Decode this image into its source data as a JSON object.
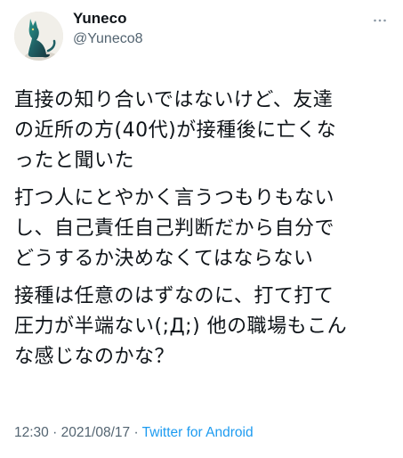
{
  "user": {
    "display_name": "Yuneco",
    "handle": "@Yuneco8"
  },
  "header": {
    "more_icon": "more-horizontal-icon"
  },
  "tweet": {
    "paragraphs": [
      "直接の知り合いではないけど、友達\nの近所の方(40代)が接種後に亡くな\nったと聞いた",
      "打つ人にとやかく言うつもりもない\nし、自己責任自己判断だから自分で\nどうするか決めなくてはならない",
      "接種は任意のはずなのに、打て打て\n圧力が半端ない(;Д;) 他の職場もこん\nな感じなのかな？"
    ]
  },
  "meta": {
    "time": "12:30",
    "separator_1": " · ",
    "date": "2021/08/17",
    "separator_2": " · ",
    "source": "Twitter for Android"
  },
  "colors": {
    "text": "#0f1419",
    "secondary": "#536471",
    "link": "#1d9bf0"
  }
}
